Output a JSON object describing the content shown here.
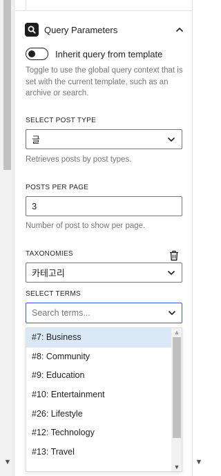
{
  "panel": {
    "title": "Query Parameters"
  },
  "inherit_toggle": {
    "label": "Inherit query from template",
    "checked": false,
    "help": "Toggle to use the global query context that is set with the current template, such as an archive or search."
  },
  "post_type": {
    "label": "SELECT POST TYPE",
    "value": "글",
    "help": "Retrieves posts by post types."
  },
  "posts_per_page": {
    "label": "POSTS PER PAGE",
    "value": "3",
    "help": "Number of post to show per page."
  },
  "taxonomies": {
    "label": "TAXONOMIES",
    "value": "카테고리"
  },
  "terms": {
    "label": "SELECT TERMS",
    "placeholder": "Search terms...",
    "options": [
      "#7: Business",
      "#8: Community",
      "#9: Education",
      "#10: Entertainment",
      "#26: Lifestyle",
      "#12: Technology",
      "#13: Travel"
    ],
    "highlighted_index": 0
  },
  "icons": {
    "panel": "query-loop-icon",
    "collapse": "chevron-up-icon",
    "select": "chevron-down-icon",
    "delete": "trash-icon"
  },
  "colors": {
    "accent": "#3858e9",
    "highlight": "#dbe9f7"
  }
}
